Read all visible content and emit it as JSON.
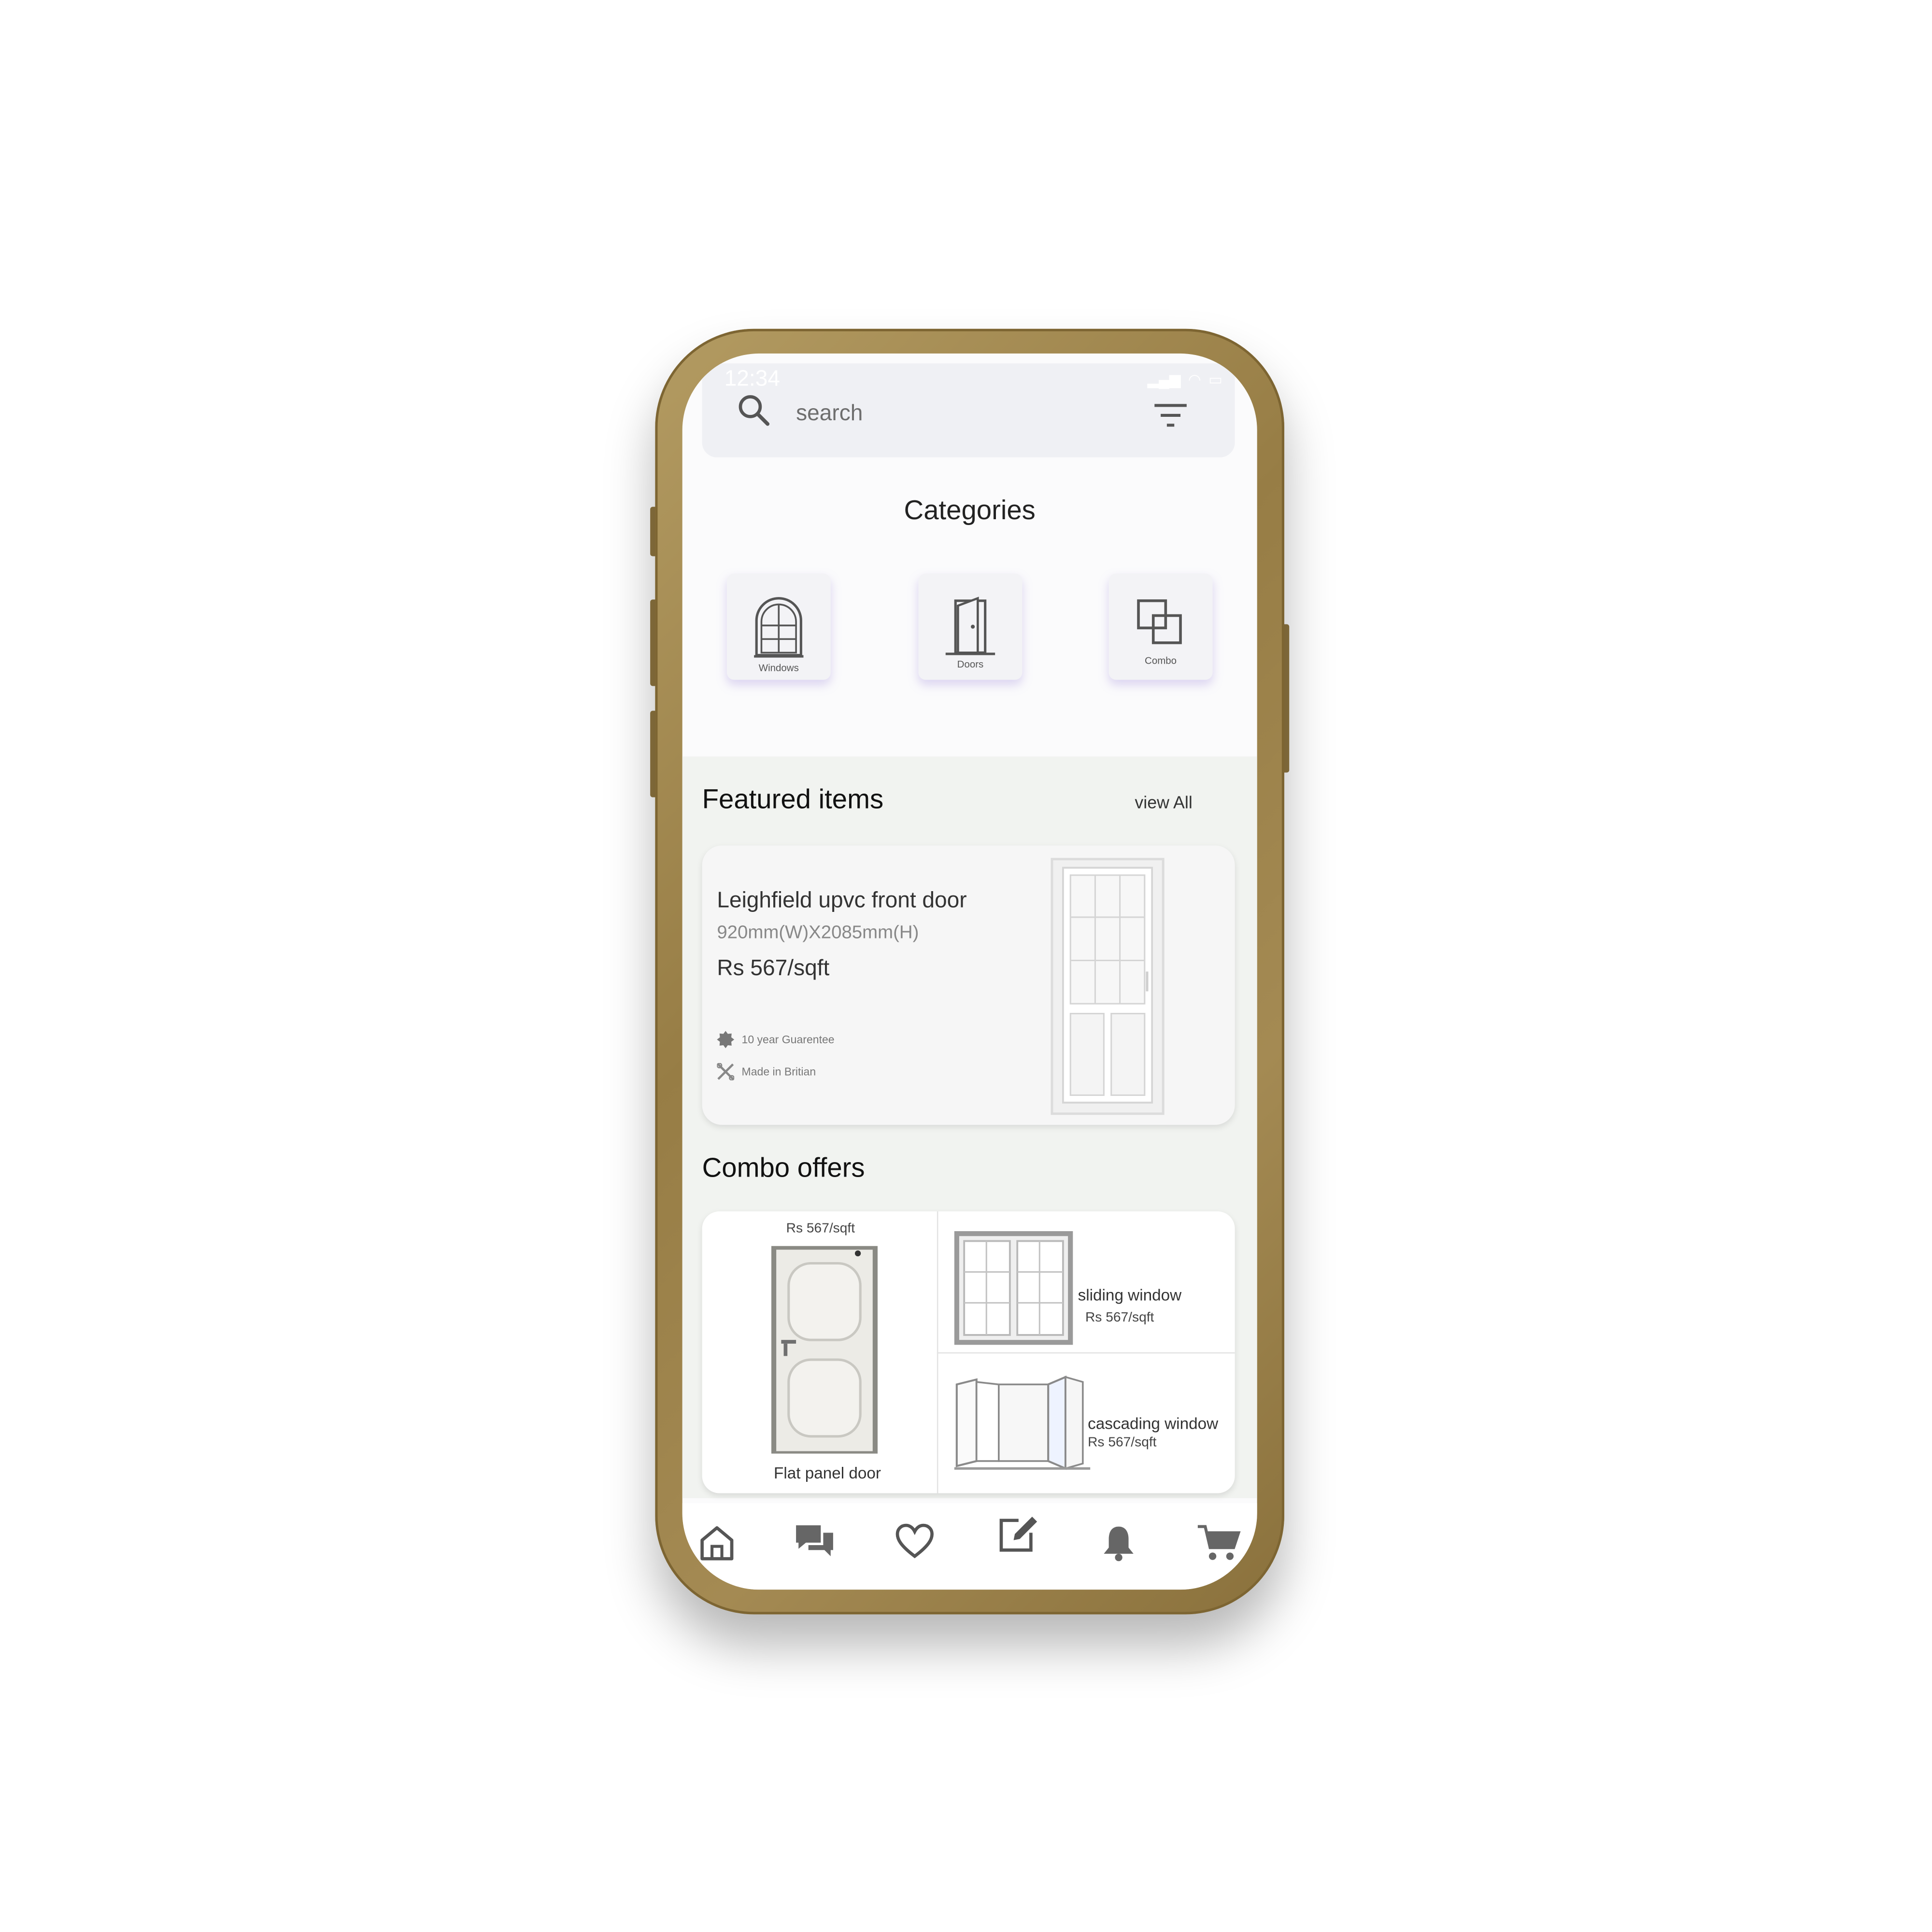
{
  "status_bar": {
    "time": "12:34"
  },
  "search": {
    "placeholder": "search"
  },
  "categories": {
    "title": "Categories",
    "items": [
      {
        "label": "Windows",
        "icon": "arched-window-icon"
      },
      {
        "label": "Doors",
        "icon": "door-icon"
      },
      {
        "label": "Combo",
        "icon": "combo-squares-icon"
      }
    ]
  },
  "featured": {
    "title": "Featured items",
    "view_all": "view All",
    "product": {
      "name": "Leighfield upvc front door",
      "dimensions": "920mm(W)X2085mm(H)",
      "price": "Rs 567/sqft",
      "features": [
        "10 year Guarentee",
        "Made in Britian"
      ]
    }
  },
  "combo": {
    "title": "Combo offers",
    "items": [
      {
        "name": "Flat panel door",
        "price": "Rs 567/sqft"
      },
      {
        "name": "sliding window",
        "price": "Rs 567/sqft"
      },
      {
        "name": "cascading window",
        "price": "Rs 567/sqft"
      }
    ]
  },
  "bottom_nav": [
    "home-icon",
    "chat-icon",
    "heart-icon",
    "edit-icon",
    "bell-icon",
    "cart-icon"
  ],
  "colors": {
    "phone_frame": "#a48a53",
    "section_bg": "#f1f3f0",
    "card_shadow_accent": "#a08cdc"
  }
}
